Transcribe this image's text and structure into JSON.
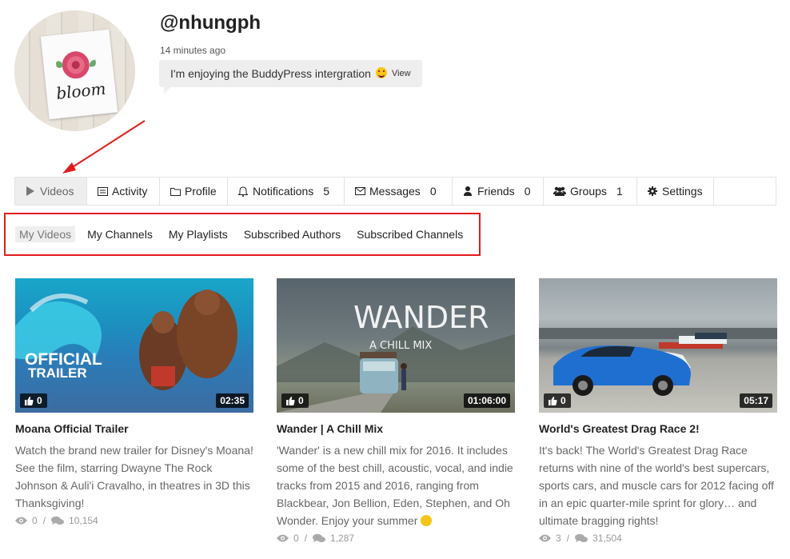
{
  "profile": {
    "username": "@nhungph",
    "time_ago": "14 minutes ago",
    "status_text": "I'm enjoying the BuddyPress intergration",
    "status_link": "View",
    "avatar_text": "bloom"
  },
  "nav": {
    "tabs": [
      {
        "label": "Videos",
        "icon": "play-icon",
        "count": ""
      },
      {
        "label": "Activity",
        "icon": "activity-icon",
        "count": ""
      },
      {
        "label": "Profile",
        "icon": "folder-icon",
        "count": ""
      },
      {
        "label": "Notifications",
        "icon": "bell-icon",
        "count": "5"
      },
      {
        "label": "Messages",
        "icon": "envelope-icon",
        "count": "0"
      },
      {
        "label": "Friends",
        "icon": "user-icon",
        "count": "0"
      },
      {
        "label": "Groups",
        "icon": "users-icon",
        "count": "1"
      },
      {
        "label": "Settings",
        "icon": "gear-icon",
        "count": ""
      }
    ]
  },
  "subnav": {
    "items": [
      "My Videos",
      "My Channels",
      "My Playlists",
      "Subscribed Authors",
      "Subscribed Channels"
    ]
  },
  "videos": [
    {
      "title": "Moana Official Trailer",
      "description": "Watch the brand new trailer for Disney's Moana! See the film, starring Dwayne The Rock Johnson & Auli'i Cravalho, in theatres in 3D this Thanksgiving!",
      "likes": "0",
      "duration": "02:35",
      "views": "0",
      "comments": "10,154",
      "thumb_text_1": "OFFICIAL",
      "thumb_text_2": "TRAILER"
    },
    {
      "title": "Wander | A Chill Mix",
      "description": "'Wander' is a new chill mix for 2016. It includes some of the best chill, acoustic, vocal, and indie tracks from 2015 and 2016, ranging from Blackbear, Jon Bellion, Eden, Stephen, and Oh Wonder. Enjoy your summer",
      "likes": "0",
      "duration": "01:06:00",
      "views": "0",
      "comments": "1,287",
      "thumb_text_1": "WANDER",
      "thumb_text_2": "A CHILL MIX"
    },
    {
      "title": "World's Greatest Drag Race 2!",
      "description": "It's back! The World's Greatest Drag Race returns with nine of the world's best supercars, sports cars, and muscle cars for 2012 facing off in an epic quarter-mile sprint for glory… and ultimate bragging rights!",
      "likes": "0",
      "duration": "05:17",
      "views": "3",
      "comments": "31,504"
    }
  ],
  "colors": {
    "highlight_red": "#e21b1b",
    "active_tab_bg": "#eeeeee"
  }
}
